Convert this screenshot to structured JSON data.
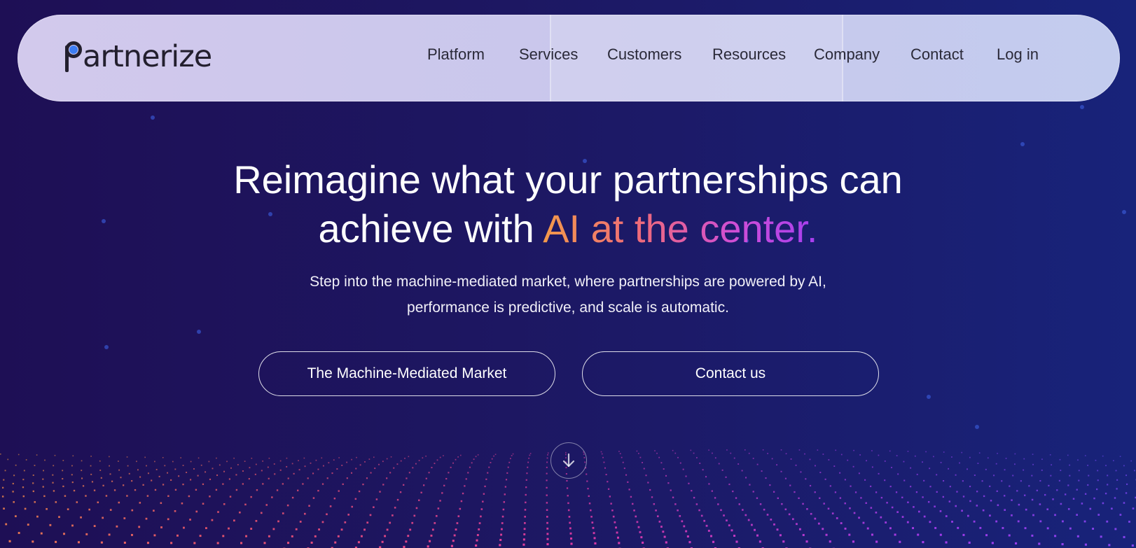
{
  "brand": {
    "name": "Partnerize",
    "name_rest": "artnerize",
    "accent_color": "#3d7df2"
  },
  "nav": {
    "links": [
      "Platform",
      "Services",
      "Customers",
      "Resources",
      "Company",
      "Contact",
      "Log in"
    ]
  },
  "hero": {
    "title_line1": "Reimagine what your partnerships can",
    "title_line2_plain": "achieve with ",
    "title_line2_gradient": "AI at the center.",
    "subtitle_line1": "Step into the machine-mediated market, where partnerships are powered by AI,",
    "subtitle_line2": "performance is predictive, and scale is automatic.",
    "gradient_colors": [
      "#f39a4a",
      "#ef6b7a",
      "#cf4ed6",
      "#a63ef0"
    ]
  },
  "buttons": {
    "primary": "The Machine-Mediated Market",
    "secondary": "Contact us"
  },
  "icons": {
    "scroll": "arrow-down-icon"
  },
  "colors": {
    "background_start": "#1e0f55",
    "background_end": "#18237a"
  }
}
